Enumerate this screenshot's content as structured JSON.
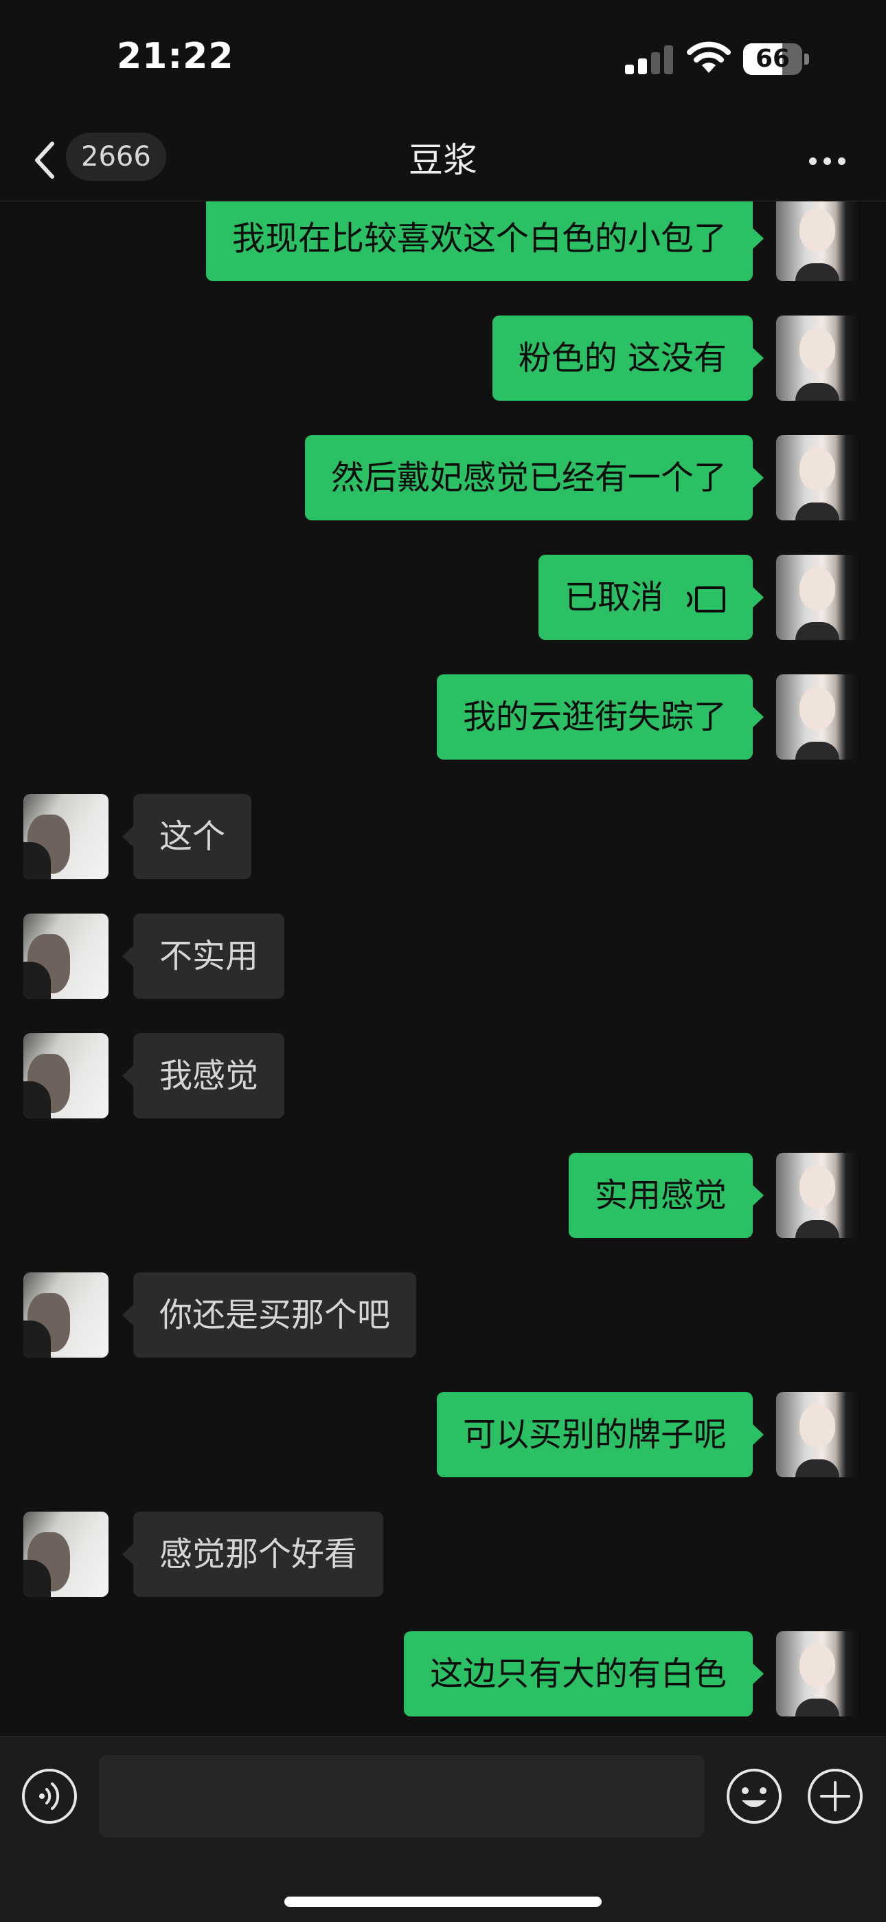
{
  "status_bar": {
    "time": "21:22",
    "battery": "66",
    "battery_level_percent": 66
  },
  "nav": {
    "unread_count": "2666",
    "title": "豆浆",
    "icons": {
      "back": "chevron-left-icon",
      "more": "more-dots-icon"
    }
  },
  "messages": [
    {
      "sender": "me",
      "text": "我现在比较喜欢这个白色的小包了"
    },
    {
      "sender": "me",
      "text": "粉色的 这没有"
    },
    {
      "sender": "me",
      "text": "然后戴妃感觉已经有一个了"
    },
    {
      "sender": "me",
      "text": "已取消",
      "icon": "voice-call-icon"
    },
    {
      "sender": "me",
      "text": "我的云逛街失踪了"
    },
    {
      "sender": "friend",
      "text": "这个"
    },
    {
      "sender": "friend",
      "text": "不实用"
    },
    {
      "sender": "friend",
      "text": "我感觉"
    },
    {
      "sender": "me",
      "text": "实用感觉"
    },
    {
      "sender": "friend",
      "text": "你还是买那个吧"
    },
    {
      "sender": "me",
      "text": "可以买别的牌子呢"
    },
    {
      "sender": "friend",
      "text": "感觉那个好看"
    },
    {
      "sender": "me",
      "text": "这边只有大的有白色"
    }
  ],
  "input_bar": {
    "value": "",
    "icons": {
      "voice": "voice-input-icon",
      "emoji": "emoji-icon",
      "plus": "plus-icon"
    }
  },
  "colors": {
    "background": "#111111",
    "outgoing_bubble": "#2ac063",
    "incoming_bubble": "#2b2b2b",
    "input_bar": "#1c1c1c"
  }
}
